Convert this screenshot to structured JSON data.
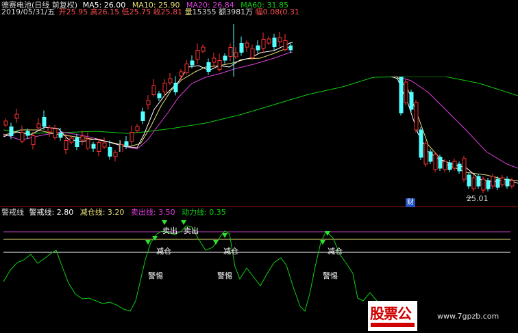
{
  "header": {
    "title": "德赛电池(日线 前复权)",
    "ma5": "MA5: 26.00",
    "ma10": "MA10: 25.90",
    "ma20": "MA20: 26.84",
    "ma60": "MA60: 31.85",
    "date": "2019/05/31/五",
    "open_label": "开",
    "open": "25.95",
    "high_label": "高",
    "high": "26.15",
    "low_label": "低",
    "low": "25.75",
    "close_label": "收",
    "close": "25.81",
    "vol_label": "量",
    "vol": "15355",
    "amt_label": "额",
    "amt": "3981万",
    "chg_label": "幅",
    "chg": "0.08(0.31"
  },
  "main_chart": {
    "low_marker": "25.01",
    "fin_badge": "财"
  },
  "indicator": {
    "name": "警戒线",
    "warn_label": "警戒线: 2.80",
    "hold_label": "减仓线: 3.20",
    "sell_label": "卖出线: 3.50",
    "power_label": "动力线: 0.35",
    "sell_text": "卖出",
    "reduce_text": "减仓",
    "alert_text": "警惕"
  },
  "watermark": {
    "brand": "股票公",
    "site": "www.7gpzb.com"
  },
  "colors": {
    "up": "#ff3232",
    "down": "#54ffff",
    "ma5": "#ffffff",
    "ma10": "#e8e07a",
    "ma20": "#e040e0",
    "ma60": "#10d010",
    "sell_line": "#c040c0",
    "hold_line": "#e8e07a",
    "warn_line": "#ffffff",
    "power": "#10d010"
  },
  "chart_data": {
    "type": "candlestick",
    "y_low_marker": 25.01,
    "indicator_levels": {
      "sell": 3.5,
      "reduce": 3.2,
      "warn": 2.8
    }
  }
}
